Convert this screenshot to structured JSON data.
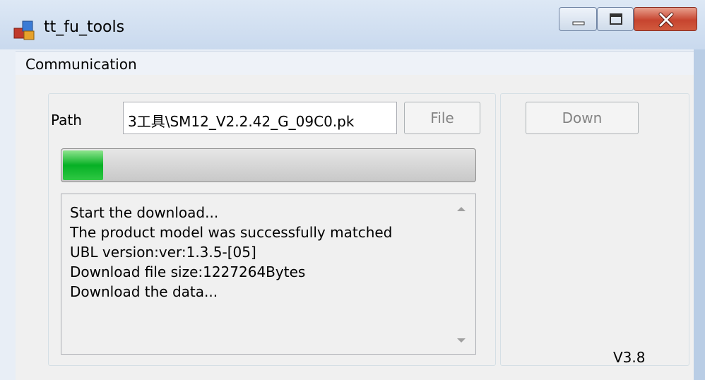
{
  "window": {
    "title": "tt_fu_tools",
    "icon": "app-icon"
  },
  "caption_buttons": {
    "minimize_icon": "minimize-icon",
    "maximize_icon": "maximize-icon",
    "close_icon": "close-icon"
  },
  "menubar": {
    "items": [
      {
        "label": "Communication"
      }
    ]
  },
  "form": {
    "path_label": "Path",
    "path_value": "3工具\\SM12_V2.2.42_G_09C0.pk",
    "file_button": "File",
    "down_button": "Down"
  },
  "progress": {
    "value_percent": 10
  },
  "log": {
    "lines": [
      "Start the download...",
      "The product model was successfully matched",
      "UBL version:ver:1.3.5-[05]",
      "Download file size:1227264Bytes",
      "Download the data..."
    ]
  },
  "version": "V3.8",
  "colors": {
    "progress_fill": "#06b025",
    "close_button": "#c7442f",
    "disabled_text": "#838383"
  }
}
